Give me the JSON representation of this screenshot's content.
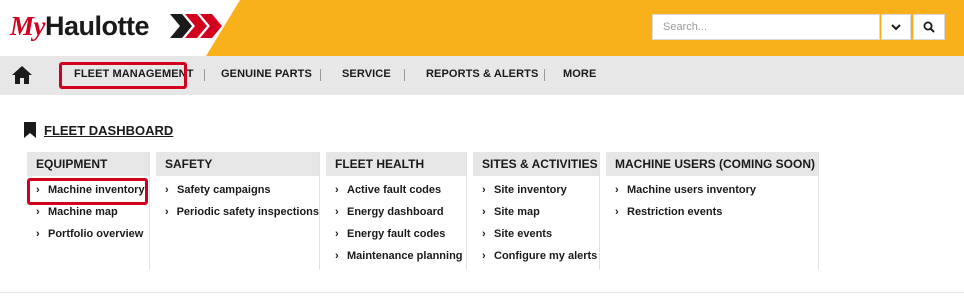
{
  "brand": {
    "logo_prefix": "My",
    "logo_name": "Haulotte",
    "color_red": "#d2001e",
    "color_yellow": "#f8b11a"
  },
  "search": {
    "placeholder": "Search..."
  },
  "nav": {
    "items": [
      {
        "label": "FLEET MANAGEMENT",
        "active": true
      },
      {
        "label": "GENUINE PARTS"
      },
      {
        "label": "SERVICE"
      },
      {
        "label": "REPORTS & ALERTS"
      },
      {
        "label": "MORE"
      }
    ]
  },
  "dashboard": {
    "title": "FLEET DASHBOARD",
    "columns": [
      {
        "heading": "EQUIPMENT",
        "items": [
          "Machine inventory",
          "Machine map",
          "Portfolio overview"
        ]
      },
      {
        "heading": "SAFETY",
        "items": [
          "Safety campaigns",
          "Periodic safety inspections"
        ]
      },
      {
        "heading": "FLEET HEALTH",
        "items": [
          "Active fault codes",
          "Energy dashboard",
          "Energy fault codes",
          "Maintenance planning"
        ]
      },
      {
        "heading": "SITES & ACTIVITIES",
        "items": [
          "Site inventory",
          "Site map",
          "Site events",
          "Configure my alerts"
        ]
      },
      {
        "heading": "MACHINE USERS (COMING SOON)",
        "items": [
          "Machine users inventory",
          "Restriction events"
        ]
      }
    ]
  }
}
